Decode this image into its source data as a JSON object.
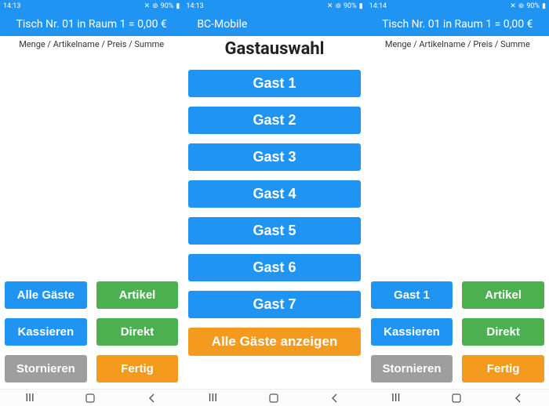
{
  "status": {
    "time1": "14:13",
    "time2": "14:13",
    "time3": "14:14",
    "battery": "90%"
  },
  "left": {
    "appbar": "Tisch Nr. 01 in Raum 1 = 0,00 €",
    "sub": "Menge / Artikelname / Preis / Summe",
    "buttons": {
      "b1": "Alle Gäste",
      "b2": "Artikel",
      "b3": "Kassieren",
      "b4": "Direkt",
      "b5": "Stornieren",
      "b6": "Fertig"
    }
  },
  "middle": {
    "appbar": "BC-Mobile",
    "title": "Gastauswahl",
    "guests": {
      "g1": "Gast 1",
      "g2": "Gast 2",
      "g3": "Gast 3",
      "g4": "Gast 4",
      "g5": "Gast 5",
      "g6": "Gast 6",
      "g7": "Gast 7",
      "all": "Alle Gäste anzeigen"
    }
  },
  "right": {
    "appbar": "Tisch Nr. 01 in Raum 1 = 0,00 €",
    "sub": "Menge / Artikelname / Preis / Summe",
    "buttons": {
      "b1": "Gast 1",
      "b2": "Artikel",
      "b3": "Kassieren",
      "b4": "Direkt",
      "b5": "Stornieren",
      "b6": "Fertig"
    }
  }
}
